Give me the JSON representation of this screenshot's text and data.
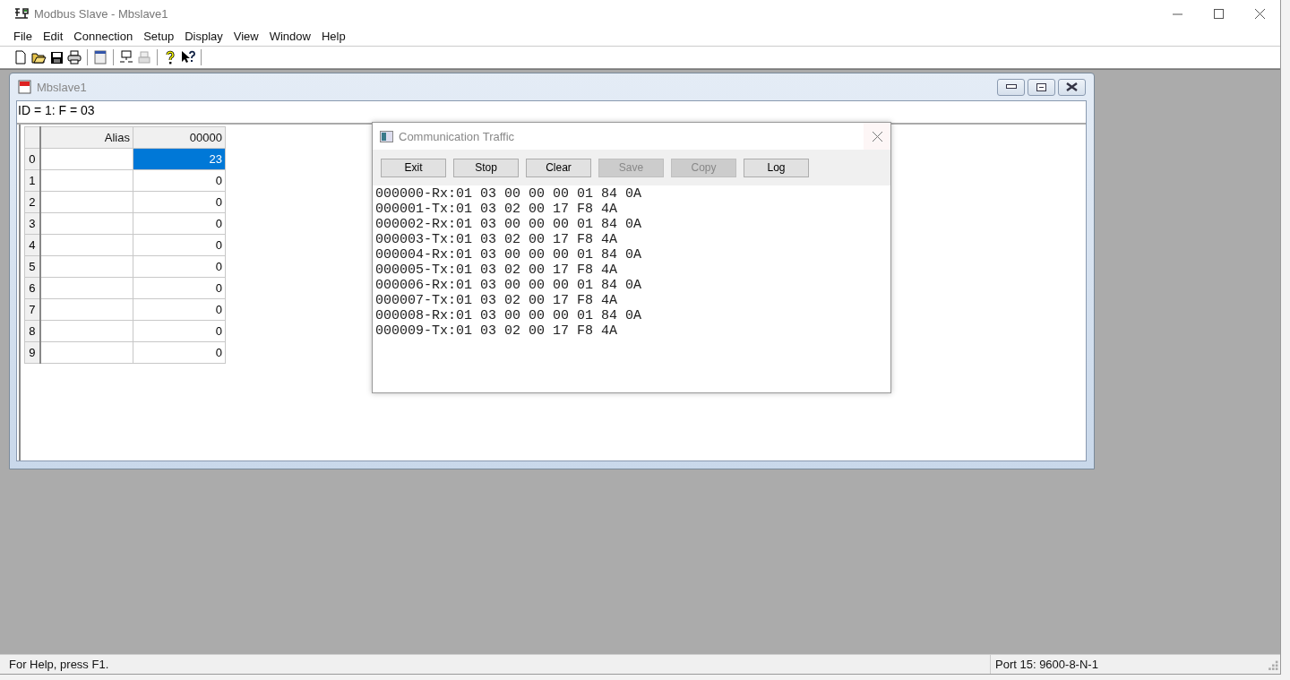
{
  "window": {
    "title": "Modbus Slave - Mbslave1"
  },
  "menu": [
    "File",
    "Edit",
    "Connection",
    "Setup",
    "Display",
    "View",
    "Window",
    "Help"
  ],
  "child_window": {
    "title": "Mbslave1",
    "header": "ID = 1: F = 03",
    "table": {
      "columns": [
        "Alias",
        "00000"
      ],
      "rows": [
        {
          "index": "0",
          "alias": "",
          "value": "23",
          "selected": true
        },
        {
          "index": "1",
          "alias": "",
          "value": "0",
          "selected": false
        },
        {
          "index": "2",
          "alias": "",
          "value": "0",
          "selected": false
        },
        {
          "index": "3",
          "alias": "",
          "value": "0",
          "selected": false
        },
        {
          "index": "4",
          "alias": "",
          "value": "0",
          "selected": false
        },
        {
          "index": "5",
          "alias": "",
          "value": "0",
          "selected": false
        },
        {
          "index": "6",
          "alias": "",
          "value": "0",
          "selected": false
        },
        {
          "index": "7",
          "alias": "",
          "value": "0",
          "selected": false
        },
        {
          "index": "8",
          "alias": "",
          "value": "0",
          "selected": false
        },
        {
          "index": "9",
          "alias": "",
          "value": "0",
          "selected": false
        }
      ]
    }
  },
  "traffic_dialog": {
    "title": "Communication Traffic",
    "buttons": [
      {
        "label": "Exit",
        "disabled": false
      },
      {
        "label": "Stop",
        "disabled": false
      },
      {
        "label": "Clear",
        "disabled": false
      },
      {
        "label": "Save",
        "disabled": true
      },
      {
        "label": "Copy",
        "disabled": true
      },
      {
        "label": "Log",
        "disabled": false
      }
    ],
    "log": [
      "000000-Rx:01 03 00 00 00 01 84 0A",
      "000001-Tx:01 03 02 00 17 F8 4A",
      "000002-Rx:01 03 00 00 00 01 84 0A",
      "000003-Tx:01 03 02 00 17 F8 4A",
      "000004-Rx:01 03 00 00 00 01 84 0A",
      "000005-Tx:01 03 02 00 17 F8 4A",
      "000006-Rx:01 03 00 00 00 01 84 0A",
      "000007-Tx:01 03 02 00 17 F8 4A",
      "000008-Rx:01 03 00 00 00 01 84 0A",
      "000009-Tx:01 03 02 00 17 F8 4A"
    ]
  },
  "status_bar": {
    "message": "For Help, press F1.",
    "port": "Port 15: 9600-8-N-1"
  }
}
